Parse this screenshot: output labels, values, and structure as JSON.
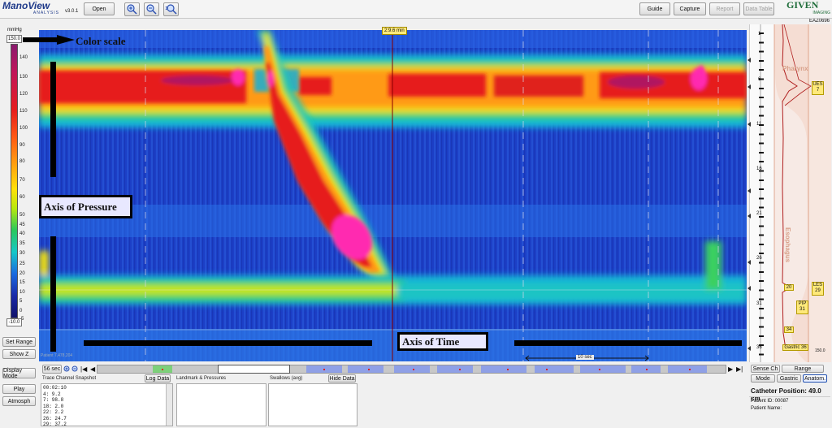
{
  "app": {
    "logo": "ManoView",
    "logo_sub": "ANALYSIS",
    "version": "v3.0.1"
  },
  "toolbar": {
    "open": "Open",
    "guide": "Guide",
    "capture": "Capture",
    "report": "Report",
    "data_table": "Data Table",
    "brand": "GIVEN",
    "brand_sub": "IMAGING"
  },
  "patient_code": "EAZ0696",
  "time_cursor": "2:9.6 min",
  "color_scale": {
    "unit": "mmHg",
    "max_value": "150.0",
    "min_value": "-10.0",
    "ticks": [
      "140",
      "130",
      "120",
      "110",
      "100",
      "90",
      "80",
      "70",
      "60",
      "50",
      "45",
      "40",
      "35",
      "30",
      "25",
      "20",
      "15",
      "10",
      "5",
      "0",
      "-5"
    ]
  },
  "annotations": {
    "color_scale": "Color scale",
    "axis_pressure": "Axis of Pressure",
    "axis_time": "Axis of Time"
  },
  "plot": {
    "footer_text": "Patient 7,478,204",
    "scale_bar": "10 sec"
  },
  "left_buttons": {
    "set_range": "Set Range",
    "show_z": "Show Z",
    "display_mode": "Display Mode",
    "play": "Play",
    "atmosph": "Atmosph"
  },
  "timeline": {
    "window": "56 sec"
  },
  "panels": {
    "trace": {
      "title": "Trace Channel Snapshot",
      "button": "Log Data",
      "lines": [
        "00:02:10",
        "4: 9.2",
        "7: 98.8",
        "18: 2.0",
        "22: 2.2",
        "26: 24.7",
        "29: 37.2"
      ]
    },
    "landmark": {
      "title": "Landmark & Pressures"
    },
    "swallows": {
      "title": "Swallows (avg)",
      "button": "Hide Data"
    }
  },
  "anatomy": {
    "channels": [
      "1",
      "6",
      "11",
      "16",
      "21",
      "26",
      "31",
      "36"
    ],
    "pharynx": "Pharynx",
    "esophagus": "Esophagus",
    "markers": {
      "ues": "UES",
      "ues_value": "7",
      "value_20": "20",
      "les": "LES",
      "les_value": "29",
      "pip": "PIP",
      "pip_value": "31",
      "value_34": "34",
      "gastric": "Gastric 36",
      "value_150": "150.0"
    },
    "sense_ch": "Sense Ch",
    "range": "Range",
    "mode": "Mode",
    "gastric_btn": "Gastric",
    "anatom": "Anatom.",
    "catheter_position": "Catheter Position: 49.0 cm",
    "patient_id": "Patient ID: 00087",
    "patient_name": "Patient Name:"
  },
  "colors": {
    "plot_blue": "#1a3fc8",
    "high_red": "#d81818",
    "peak_pink": "#ff2bb0",
    "selected_segment": "#ff3030",
    "timeline_segment": "#8fa0e6"
  }
}
